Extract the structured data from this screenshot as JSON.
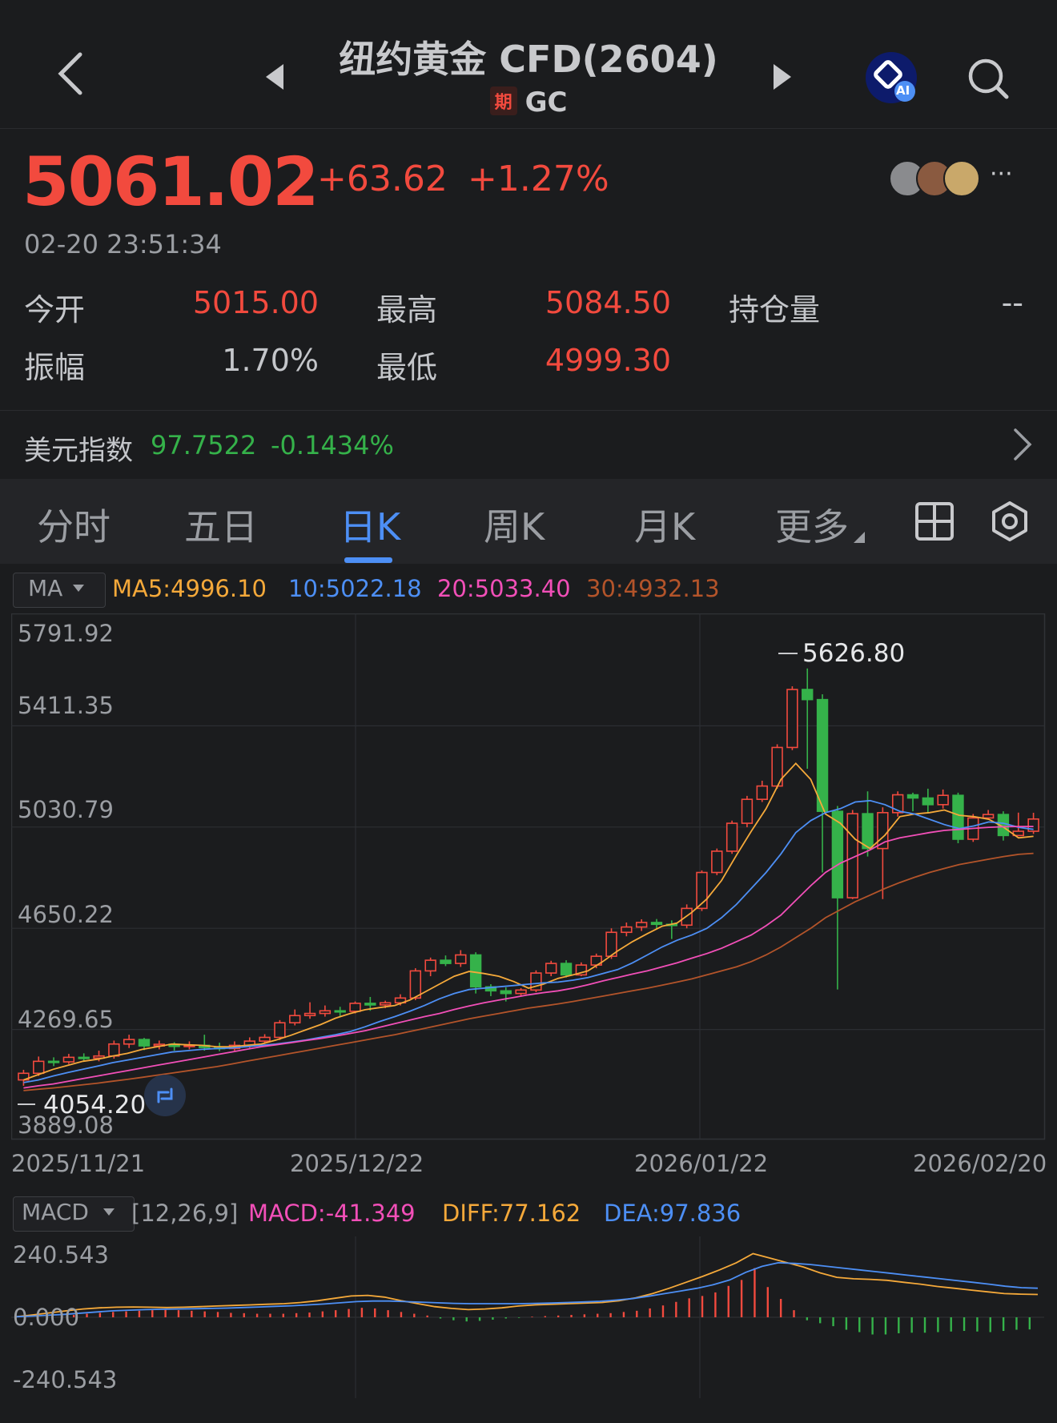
{
  "header": {
    "title": "纽约黄金 CFD(2604)",
    "badge": "期",
    "code": "GC",
    "ai_label": "AI"
  },
  "quote": {
    "price": "5061.02",
    "change": "+63.62",
    "change_pct": "+1.27%",
    "timestamp": "02-20 23:51:34",
    "more": "···"
  },
  "stats": {
    "open_label": "今开",
    "open": "5015.00",
    "high_label": "最高",
    "high": "5084.50",
    "oi_label": "持仓量",
    "oi": "--",
    "amp_label": "振幅",
    "amp": "1.70%",
    "low_label": "最低",
    "low": "4999.30"
  },
  "usd_index": {
    "label": "美元指数",
    "value": "97.7522",
    "change": "-0.1434%"
  },
  "tabs": [
    {
      "label": "分时"
    },
    {
      "label": "五日"
    },
    {
      "label": "日K"
    },
    {
      "label": "周K"
    },
    {
      "label": "月K"
    },
    {
      "label": "更多"
    }
  ],
  "ma_panel": {
    "selector": "MA",
    "ma5": "MA5:4996.10",
    "ma10": "10:5022.18",
    "ma20": "20:5033.40",
    "ma30": "30:4932.13",
    "y_labels": [
      "5791.92",
      "5411.35",
      "5030.79",
      "4650.22",
      "4269.65",
      "3889.08"
    ],
    "max_label": "5626.80",
    "min_label": "4054.20",
    "dates": [
      "2025/11/21",
      "2025/12/22",
      "2026/01/22",
      "2026/02/20"
    ]
  },
  "macd_panel": {
    "selector": "MACD",
    "params": "[12,26,9]",
    "macd": "MACD:-41.349",
    "diff": "DIFF:77.162",
    "dea": "DEA:97.836",
    "y_labels": [
      "240.543",
      "0.000",
      "-240.543"
    ]
  },
  "colors": {
    "up": "#f24a3e",
    "down": "#35b24a",
    "ma5": "#f5a93a",
    "ma10": "#4d8ff5",
    "ma20": "#f24fb8",
    "ma30": "#b3542a",
    "accent": "#4d8ff5"
  },
  "chart_data": [
    {
      "type": "candlestick",
      "title": "",
      "ylim": [
        3889.08,
        5791.92
      ],
      "x_ticks": [
        "2025/11/21",
        "2025/12/22",
        "2026/01/22",
        "2026/02/20"
      ],
      "candles": [
        [
          4080,
          4105,
          4058,
          4118
        ],
        [
          4105,
          4150,
          4095,
          4168
        ],
        [
          4150,
          4148,
          4132,
          4165
        ],
        [
          4148,
          4165,
          4140,
          4178
        ],
        [
          4165,
          4162,
          4150,
          4180
        ],
        [
          4162,
          4170,
          4150,
          4190
        ],
        [
          4170,
          4215,
          4160,
          4228
        ],
        [
          4215,
          4232,
          4200,
          4250
        ],
        [
          4232,
          4208,
          4192,
          4238
        ],
        [
          4208,
          4214,
          4195,
          4228
        ],
        [
          4214,
          4206,
          4190,
          4222
        ],
        [
          4206,
          4210,
          4195,
          4225
        ],
        [
          4210,
          4202,
          4190,
          4250
        ],
        [
          4202,
          4198,
          4188,
          4220
        ],
        [
          4198,
          4210,
          4190,
          4225
        ],
        [
          4210,
          4226,
          4200,
          4240
        ],
        [
          4226,
          4240,
          4215,
          4252
        ],
        [
          4240,
          4295,
          4230,
          4305
        ],
        [
          4295,
          4322,
          4285,
          4345
        ],
        [
          4322,
          4330,
          4310,
          4372
        ],
        [
          4330,
          4340,
          4318,
          4360
        ],
        [
          4340,
          4338,
          4320,
          4355
        ],
        [
          4338,
          4368,
          4330,
          4375
        ],
        [
          4368,
          4362,
          4340,
          4392
        ],
        [
          4362,
          4370,
          4350,
          4378
        ],
        [
          4370,
          4388,
          4360,
          4402
        ],
        [
          4388,
          4490,
          4380,
          4500
        ],
        [
          4490,
          4530,
          4470,
          4540
        ],
        [
          4530,
          4518,
          4508,
          4548
        ],
        [
          4518,
          4550,
          4505,
          4568
        ],
        [
          4550,
          4430,
          4405,
          4560
        ],
        [
          4430,
          4415,
          4395,
          4440
        ],
        [
          4415,
          4405,
          4375,
          4428
        ],
        [
          4405,
          4418,
          4395,
          4425
        ],
        [
          4418,
          4482,
          4410,
          4492
        ],
        [
          4482,
          4518,
          4470,
          4528
        ],
        [
          4518,
          4475,
          4465,
          4530
        ],
        [
          4475,
          4512,
          4470,
          4522
        ],
        [
          4512,
          4545,
          4500,
          4555
        ],
        [
          4545,
          4635,
          4535,
          4650
        ],
        [
          4635,
          4655,
          4620,
          4672
        ],
        [
          4655,
          4672,
          4640,
          4684
        ],
        [
          4672,
          4665,
          4645,
          4685
        ],
        [
          4665,
          4662,
          4610,
          4680
        ],
        [
          4662,
          4725,
          4650,
          4740
        ],
        [
          4725,
          4860,
          4715,
          4868
        ],
        [
          4860,
          4940,
          4850,
          4950
        ],
        [
          4940,
          5045,
          4930,
          5055
        ],
        [
          5045,
          5135,
          5030,
          5148
        ],
        [
          5135,
          5185,
          5125,
          5205
        ],
        [
          5185,
          5330,
          5175,
          5342
        ],
        [
          5330,
          5548,
          5320,
          5560
        ],
        [
          5548,
          5510,
          5250,
          5627
        ],
        [
          5510,
          5090,
          4860,
          5530
        ],
        [
          5090,
          4765,
          4420,
          5110
        ],
        [
          4765,
          5081,
          4760,
          5095
        ],
        [
          5081,
          4950,
          4920,
          5165
        ],
        [
          4950,
          5085,
          4760,
          5105
        ],
        [
          5085,
          5152,
          5070,
          5165
        ],
        [
          5152,
          5140,
          5090,
          5160
        ],
        [
          5140,
          5115,
          5082,
          5175
        ],
        [
          5115,
          5150,
          5100,
          5172
        ],
        [
          5150,
          4985,
          4970,
          5160
        ],
        [
          4985,
          5065,
          4975,
          5080
        ],
        [
          5065,
          5078,
          5060,
          5095
        ],
        [
          5078,
          4999,
          4980,
          5090
        ],
        [
          4999,
          5015,
          4999,
          5085
        ],
        [
          5015,
          5061,
          5005,
          5084.5
        ]
      ],
      "series": [
        {
          "name": "MA5",
          "values": [
            4080,
            4100,
            4120,
            4135,
            4150,
            4158,
            4170,
            4180,
            4195,
            4205,
            4215,
            4212,
            4210,
            4205,
            4205,
            4210,
            4215,
            4230,
            4248,
            4268,
            4288,
            4312,
            4330,
            4344,
            4352,
            4360,
            4380,
            4410,
            4440,
            4470,
            4488,
            4480,
            4470,
            4450,
            4425,
            4440,
            4462,
            4475,
            4490,
            4525,
            4565,
            4600,
            4630,
            4658,
            4670,
            4710,
            4760,
            4830,
            4925,
            5015,
            5100,
            5210,
            5270,
            5210,
            5080,
            5045,
            4985,
            4950,
            5000,
            5070,
            5080,
            5085,
            5095,
            5075,
            5070,
            5060,
            5030,
            4990,
            4996
          ]
        },
        {
          "name": "MA10",
          "values": [
            4070,
            4080,
            4095,
            4108,
            4120,
            4132,
            4145,
            4155,
            4165,
            4175,
            4185,
            4190,
            4195,
            4198,
            4200,
            4205,
            4210,
            4215,
            4222,
            4230,
            4240,
            4250,
            4262,
            4280,
            4300,
            4318,
            4338,
            4360,
            4385,
            4405,
            4420,
            4425,
            4430,
            4435,
            4440,
            4445,
            4448,
            4455,
            4465,
            4480,
            4495,
            4520,
            4550,
            4580,
            4605,
            4625,
            4650,
            4690,
            4740,
            4800,
            4860,
            4930,
            5010,
            5055,
            5085,
            5100,
            5125,
            5130,
            5115,
            5090,
            5080,
            5060,
            5040,
            5025,
            5035,
            5050,
            5045,
            5030,
            5022
          ]
        },
        {
          "name": "MA20",
          "values": [
            4050,
            4058,
            4065,
            4075,
            4085,
            4095,
            4105,
            4115,
            4125,
            4135,
            4145,
            4155,
            4165,
            4175,
            4185,
            4195,
            4205,
            4212,
            4220,
            4228,
            4236,
            4245,
            4255,
            4265,
            4278,
            4292,
            4305,
            4318,
            4330,
            4345,
            4358,
            4370,
            4380,
            4390,
            4400,
            4408,
            4415,
            4425,
            4438,
            4452,
            4465,
            4478,
            4490,
            4505,
            4520,
            4538,
            4555,
            4575,
            4600,
            4625,
            4660,
            4700,
            4755,
            4810,
            4860,
            4895,
            4920,
            4945,
            4975,
            4990,
            5000,
            5010,
            5018,
            5022,
            5026,
            5030,
            5032,
            5033,
            5033
          ]
        },
        {
          "name": "MA30",
          "values": [
            4040,
            4045,
            4050,
            4056,
            4062,
            4068,
            4075,
            4082,
            4090,
            4098,
            4106,
            4114,
            4122,
            4130,
            4140,
            4150,
            4160,
            4170,
            4180,
            4190,
            4200,
            4210,
            4220,
            4230,
            4240,
            4250,
            4262,
            4274,
            4286,
            4298,
            4310,
            4320,
            4330,
            4340,
            4350,
            4358,
            4366,
            4375,
            4385,
            4395,
            4405,
            4415,
            4425,
            4436,
            4448,
            4460,
            4475,
            4490,
            4505,
            4525,
            4550,
            4580,
            4615,
            4650,
            4690,
            4720,
            4750,
            4775,
            4800,
            4822,
            4842,
            4860,
            4875,
            4890,
            4900,
            4910,
            4920,
            4928,
            4932
          ]
        }
      ]
    },
    {
      "type": "bar",
      "title": "",
      "ylim": [
        -240.543,
        240.543
      ],
      "series": [
        {
          "name": "DIFF",
          "values": [
            2,
            8,
            15,
            22,
            28,
            32,
            34,
            35,
            34,
            33,
            34,
            36,
            38,
            40,
            42,
            44,
            46,
            50,
            56,
            64,
            72,
            74,
            68,
            56,
            46,
            36,
            30,
            26,
            28,
            32,
            38,
            42,
            44,
            46,
            48,
            50,
            56,
            66,
            80,
            98,
            118,
            138,
            160,
            184,
            215,
            200,
            185,
            170,
            150,
            135,
            130,
            128,
            125,
            118,
            112,
            104,
            98,
            92,
            86,
            80,
            78,
            77
          ]
        },
        {
          "name": "DEA",
          "values": [
            2,
            4,
            7,
            10,
            14,
            18,
            22,
            24,
            26,
            27,
            28,
            29,
            30,
            31,
            33,
            35,
            37,
            39,
            42,
            45,
            49,
            53,
            55,
            55,
            53,
            51,
            49,
            47,
            46,
            46,
            46,
            46,
            47,
            48,
            50,
            52,
            54,
            58,
            63,
            71,
            80,
            89,
            98,
            110,
            126,
            152,
            172,
            184,
            182,
            178,
            172,
            166,
            160,
            154,
            148,
            142,
            136,
            130,
            124,
            118,
            112,
            105,
            100,
            98
          ]
        },
        {
          "name": "MACD",
          "values": [
            8,
            12,
            15,
            18,
            20,
            22,
            24,
            25,
            24,
            22,
            20,
            18,
            15,
            14,
            12,
            12,
            12,
            14,
            16,
            20,
            24,
            28,
            32,
            30,
            24,
            18,
            12,
            6,
            -4,
            -10,
            -14,
            -12,
            -8,
            -4,
            -2,
            2,
            4,
            6,
            8,
            10,
            12,
            14,
            18,
            22,
            30,
            40,
            52,
            64,
            72,
            84,
            106,
            126,
            166,
            102,
            62,
            24,
            -10,
            -20,
            -30,
            -42,
            -50,
            -58,
            -58,
            -54,
            -52,
            -52,
            -50,
            -48,
            -46,
            -48,
            -50,
            -46,
            -42,
            -41
          ]
        }
      ]
    }
  ]
}
